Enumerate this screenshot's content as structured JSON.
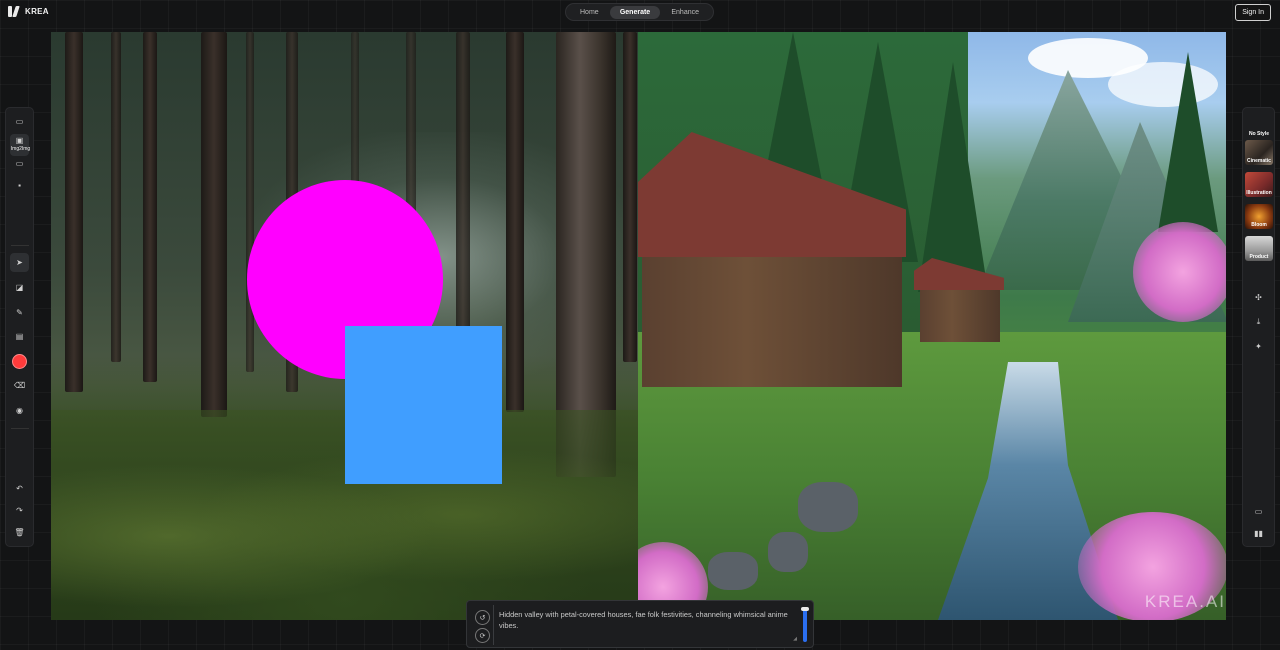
{
  "app": {
    "name": "KREA"
  },
  "nav": {
    "tabs": [
      {
        "label": "Home"
      },
      {
        "label": "Generate"
      },
      {
        "label": "Enhance"
      }
    ],
    "active": "Generate"
  },
  "header": {
    "signin_label": "Sign In"
  },
  "left_toolbar": {
    "img2img_label": "Img2Img",
    "tools": [
      {
        "icon": "upload-image-icon"
      },
      {
        "icon": "img2img-icon"
      },
      {
        "icon": "screen-capture-icon"
      },
      {
        "icon": "webcam-icon"
      },
      {
        "icon": "select-pointer-icon"
      },
      {
        "icon": "shapes-icon"
      },
      {
        "icon": "brush-icon"
      },
      {
        "icon": "image-add-icon"
      },
      {
        "icon": "color-picker-icon"
      },
      {
        "icon": "eraser-icon"
      },
      {
        "icon": "background-remove-icon"
      },
      {
        "icon": "undo-icon"
      },
      {
        "icon": "redo-icon"
      },
      {
        "icon": "trash-icon"
      }
    ],
    "active_color": "#ff3b3b"
  },
  "canvas": {
    "left_shapes": [
      {
        "type": "circle",
        "color": "#ff00ff"
      },
      {
        "type": "square",
        "color": "#409eff"
      }
    ],
    "output_watermark": "KREA.AI"
  },
  "right_toolbar": {
    "styles": [
      {
        "label": "No Style"
      },
      {
        "label": "Cinematic"
      },
      {
        "label": "Illustration"
      },
      {
        "label": "Bloom"
      },
      {
        "label": "Product"
      }
    ],
    "actions": [
      {
        "icon": "ai-strength-icon"
      },
      {
        "icon": "download-icon"
      },
      {
        "icon": "upscale-icon"
      },
      {
        "icon": "layout-single-icon"
      },
      {
        "icon": "layout-split-icon"
      }
    ]
  },
  "prompt": {
    "text": "Hidden valley with petal-covered houses, fae folk festivities, channeling whimsical anime vibes.",
    "accent_color": "#2b6ff0"
  }
}
